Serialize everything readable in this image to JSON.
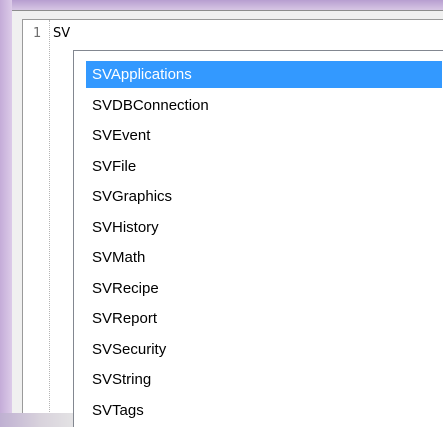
{
  "editor": {
    "line_number": "1",
    "code_text": "SV"
  },
  "autocomplete": {
    "selected_index": 0,
    "selected_color": "#3399ff",
    "items": [
      "SVApplications",
      "SVDBConnection",
      "SVEvent",
      "SVFile",
      "SVGraphics",
      "SVHistory",
      "SVMath",
      "SVRecipe",
      "SVReport",
      "SVSecurity",
      "SVString",
      "SVTags"
    ]
  }
}
